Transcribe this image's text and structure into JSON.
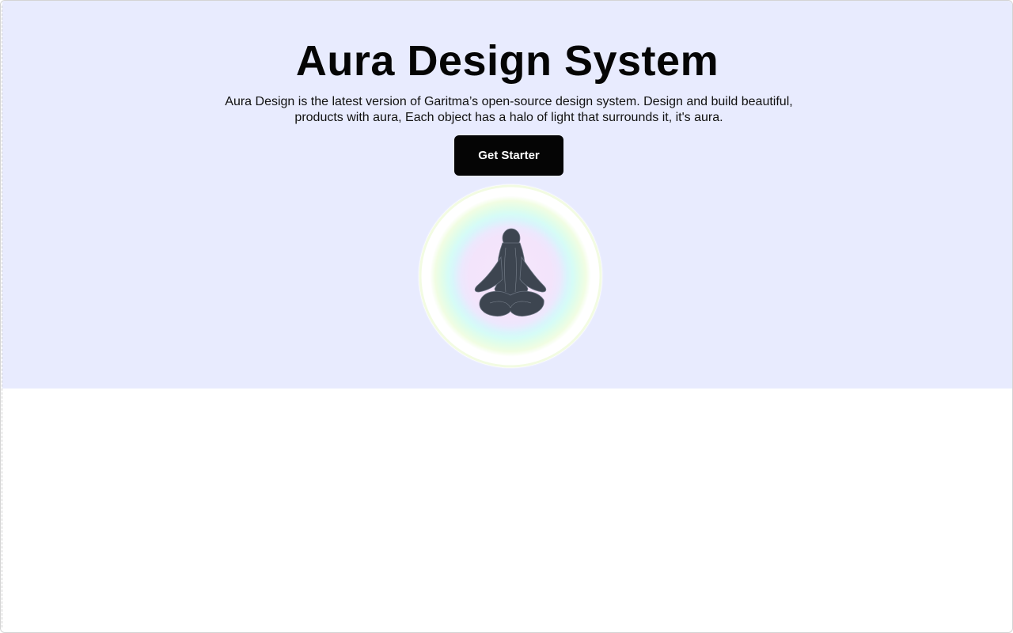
{
  "hero": {
    "title": "Aura Design System",
    "subtitle": "Aura Design is the latest version of Garitma’s open-source design system. Design and build beautiful, products with aura, Each object has a halo of light that surrounds it, it's aura.",
    "cta_label": "Get Starter",
    "image_icon": "meditating-figure-icon"
  },
  "colors": {
    "hero_background": "#e8ebfe",
    "button_background": "#050505",
    "button_text": "#ffffff",
    "title_text": "#050505"
  }
}
